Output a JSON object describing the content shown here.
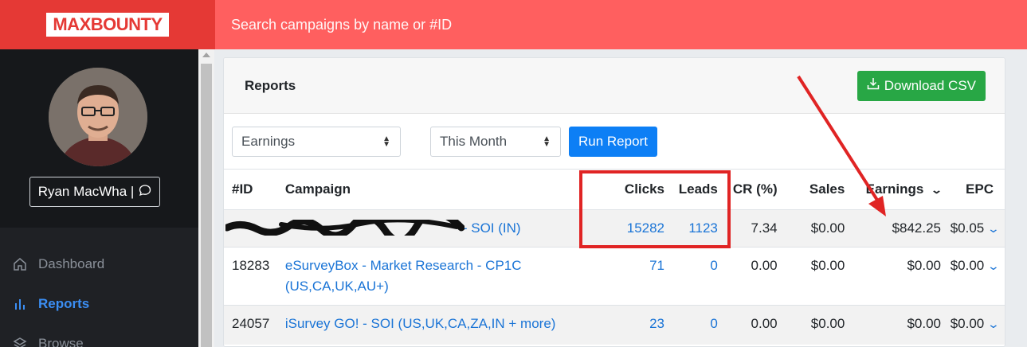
{
  "brand": {
    "logo_text": "MAXBOUNTY",
    "accent": "#e53935"
  },
  "search": {
    "placeholder": "Search campaigns by name or #ID"
  },
  "user": {
    "name": "Ryan MacWha |"
  },
  "nav": [
    {
      "label": "Dashboard",
      "icon": "home-icon"
    },
    {
      "label": "Reports",
      "icon": "bar-chart-icon",
      "active": true
    },
    {
      "label": "Browse",
      "icon": "layers-icon"
    }
  ],
  "reports": {
    "title": "Reports",
    "download_label": "Download CSV",
    "report_type": "Earnings",
    "date_range": "This Month",
    "run_label": "Run Report"
  },
  "table": {
    "headers": {
      "id": "#ID",
      "campaign": "Campaign",
      "clicks": "Clicks",
      "leads": "Leads",
      "cr": "CR (%)",
      "sales": "Sales",
      "earnings": "Earnings",
      "epc": "EPC"
    },
    "rows": [
      {
        "id": "",
        "campaign": "- SOI (IN)",
        "clicks": "15282",
        "leads": "1123",
        "cr": "7.34",
        "sales": "$0.00",
        "earnings": "$842.25",
        "epc": "$0.05"
      },
      {
        "id": "18283",
        "campaign": "eSurveyBox - Market Research - CP1C (US,CA,UK,AU+)",
        "clicks": "71",
        "leads": "0",
        "cr": "0.00",
        "sales": "$0.00",
        "earnings": "$0.00",
        "epc": "$0.00"
      },
      {
        "id": "24057",
        "campaign": "iSurvey GO! - SOI (US,UK,CA,ZA,IN + more)",
        "clicks": "23",
        "leads": "0",
        "cr": "0.00",
        "sales": "$0.00",
        "earnings": "$0.00",
        "epc": "$0.00"
      }
    ]
  }
}
